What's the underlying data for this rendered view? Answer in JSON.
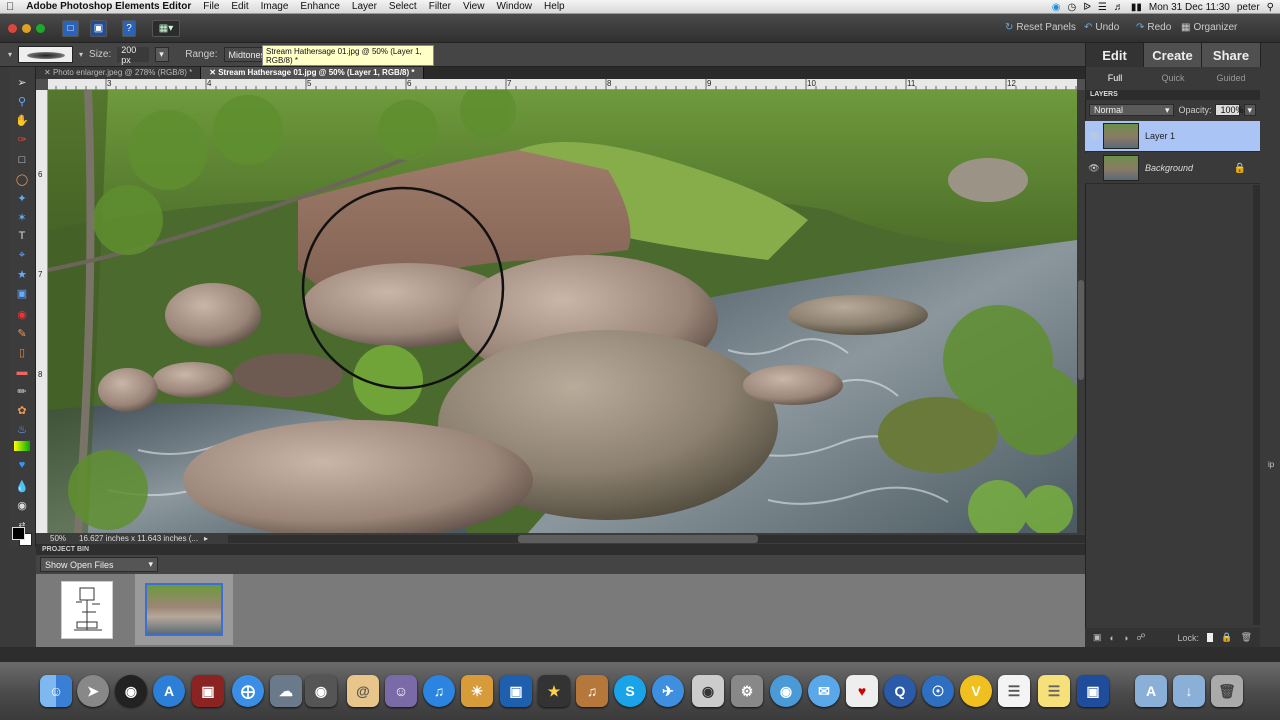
{
  "menubar": {
    "app_name": "Adobe Photoshop Elements Editor",
    "items": [
      "File",
      "Edit",
      "Image",
      "Enhance",
      "Layer",
      "Select",
      "Filter",
      "View",
      "Window",
      "Help"
    ],
    "clock": "Mon 31 Dec  11:30",
    "user": "peter"
  },
  "titlebar": {
    "reset_panels": "Reset Panels",
    "undo": "Undo",
    "redo": "Redo",
    "organizer": "Organizer"
  },
  "options": {
    "size_label": "Size:",
    "size_value": "200 px",
    "range_label": "Range:",
    "range_value": "Midtones"
  },
  "tooltip": "Stream Hathersage 01.jpg @ 50% (Layer 1, RGB/8) *",
  "tabs": [
    {
      "label": "Photo enlarger.jpeg @ 278% (RGB/8) *"
    },
    {
      "label": "Stream Hathersage 01.jpg @ 50% (Layer 1, RGB/8) *"
    }
  ],
  "ruler": {
    "h_ticks": [
      "3",
      "4",
      "5",
      "6",
      "7",
      "8",
      "9",
      "10",
      "11",
      "12"
    ],
    "v_ticks": [
      "6",
      "7",
      "8"
    ]
  },
  "status": {
    "zoom": "50%",
    "dimensions": "16.627 inches x 11.643 inches (..."
  },
  "bin": {
    "title": "PROJECT BIN",
    "show_value": "Show Open Files"
  },
  "panel": {
    "tabs": [
      "Edit",
      "Create",
      "Share"
    ],
    "subtabs": [
      "Full",
      "Quick",
      "Guided"
    ],
    "layers_title": "LAYERS",
    "blend_mode": "Normal",
    "opacity_label": "Opacity:",
    "opacity_value": "100%",
    "layers": [
      {
        "name": "Layer 1"
      },
      {
        "name": "Background"
      }
    ],
    "lock_label": "Lock:"
  },
  "stray_text": "ip",
  "colors": {
    "selected_layer": "#a9c4f5",
    "canvas_bg": "#505050"
  },
  "dock_icons": [
    "finder-icon",
    "launchpad-icon",
    "dashboard-icon",
    "app-store-icon",
    "photo-booth-icon",
    "safari-icon",
    "preview-icon",
    "facetime-icon",
    "mail-icon",
    "address-book-icon",
    "itunes-icon",
    "iphoto-icon",
    "photoshop-elements-icon",
    "imovie-icon",
    "garageband-icon",
    "skype-icon",
    "airmail-icon",
    "screenshot-icon",
    "system-preferences-icon",
    "dvd-player-icon",
    "messages-icon",
    "solitaire-icon",
    "quicktime-icon",
    "google-earth-icon",
    "vlc-icon",
    "textedit-icon",
    "stickies-icon",
    "photoshop-elements-editor-icon",
    "applications-folder-icon",
    "downloads-folder-icon",
    "trash-icon"
  ]
}
